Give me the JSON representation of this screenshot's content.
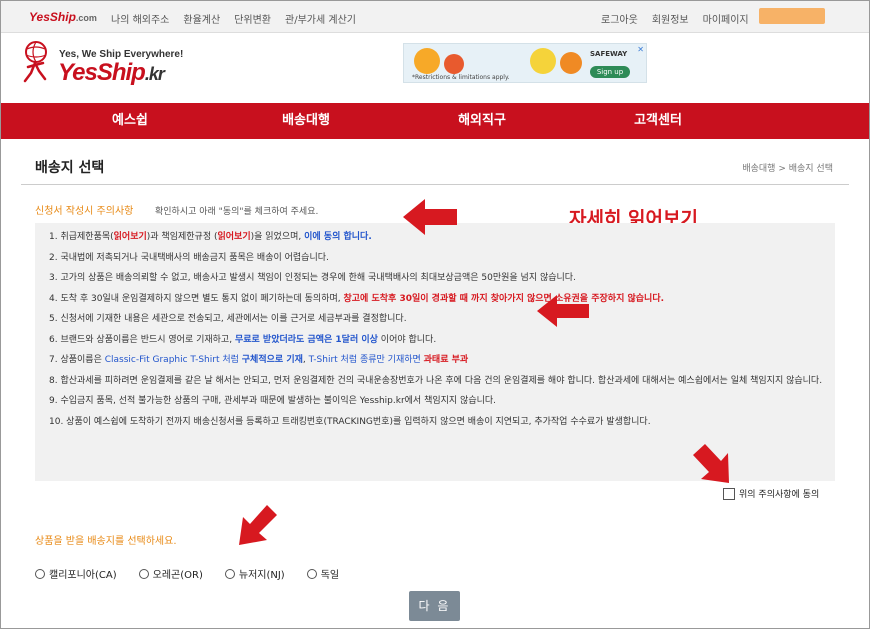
{
  "topbar": {
    "logo": "YesShip",
    "logo_suffix": ".com",
    "nav": [
      "나의 해외주소",
      "환율계산",
      "단위변환",
      "관/부가세 계산기"
    ],
    "right": [
      "로그아웃",
      "회원정보",
      "마이페이지"
    ]
  },
  "header": {
    "slogan": "Yes, We Ship Everywhere!",
    "brand": "YesShip",
    "brand_suffix": ".kr",
    "ad": {
      "brand": "SAFEWAY",
      "fine_print": "*Restrictions & limitations apply.",
      "button": "Sign up"
    }
  },
  "mainnav": [
    "예스쉽",
    "배송대행",
    "해외직구",
    "고객센터"
  ],
  "page": {
    "title": "배송지 선택",
    "breadcrumb": "배송대행 > 배송지 선택"
  },
  "notice": {
    "title": "신청서 작성시 주의사항",
    "subtitle": "확인하시고 아래 \"동의\"를 체크하여 주세요."
  },
  "annotation": "자세히 읽어보기",
  "terms": {
    "t1a": "1. 취급제한품목(",
    "t1b": "읽어보기",
    "t1c": ")과 책임제한규정 (",
    "t1d": "읽어보기",
    "t1e": ")을 읽었으며, ",
    "t1f": "이에 동의 합니다.",
    "t2": "2. 국내법에 저촉되거나 국내택배사의 배송금지 품목은 배송이 어렵습니다.",
    "t3": "3. 고가의 상품은 배송의뢰할 수 없고, 배송사고 발생시 책임이 인정되는 경우에 한해 국내택배사의 최대보상금액은 50만원을 넘지 않습니다.",
    "t4a": "4. 도착 후 30일내 운임결제하지 않으면 별도 통지 없이 폐기하는데 동의하며, ",
    "t4b": "창고에 도착후 30일이 경과할 때 까지 찾아가지 않으면 소유권을 주장하지 않습니다.",
    "t5": "5. 신청서에 기재한 내용은 세관으로 전송되고, 세관에서는 이를 근거로 세금부과를 결정합니다.",
    "t6a": "6. 브랜드와 상품이름은 반드시 영어로 기재하고, ",
    "t6b": "무료로 받았더라도 금액은 1달러 이상",
    "t6c": " 이어야 합니다.",
    "t7a": "7. 상품이름은 ",
    "t7b": "Classic-Fit Graphic T-Shirt 처럼 ",
    "t7c": "구체적으로 기재",
    "t7d": ", ",
    "t7e": "T-Shirt 처럼 종류만 기재하면 ",
    "t7f": "과태료 부과",
    "t8": "8. 합산과세를 피하려면 운임결제를 같은 날 해서는 안되고, 먼저 운임결제한 건의 국내운송장번호가 나온 후에 다음 건의 운임결제를 해야 합니다. 합산과세에 대해서는 예스쉽에서는 일체 책임지지 않습니다.",
    "t9": "9. 수입금지 품목, 선적 불가능한 상품의 구매, 관세부과 때문에 발생하는 불이익은 Yesship.kr에서 책임지지 않습니다.",
    "t10": "10. 상품이 예스쉽에 도착하기 전까지 배송신청서를 등록하고 트래킹번호(TRACKING번호)를 입력하지 않으면 배송이 지연되고, 추가작업 수수료가 발생합니다."
  },
  "agree_label": "위의 주의사항에 동의",
  "choose_label": "상품을 받을 배송지를 선택하세요.",
  "destinations": [
    "캘리포니아(CA)",
    "오레곤(OR)",
    "뉴저지(NJ)",
    "독일"
  ],
  "next_button": "다 음",
  "colors": {
    "brand_red": "#c8101e",
    "orange": "#e88a16",
    "annotation_red": "#d71920"
  }
}
